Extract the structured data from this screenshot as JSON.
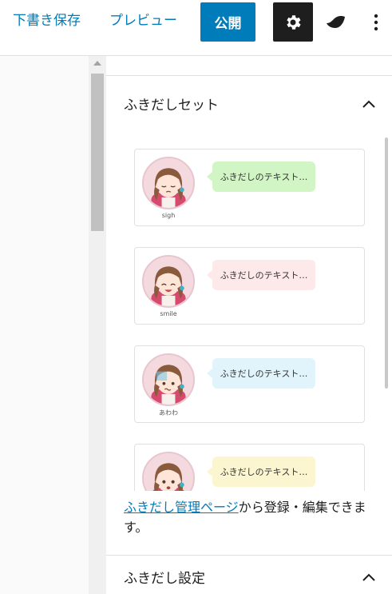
{
  "toolbar": {
    "save_draft": "下書き保存",
    "preview": "プレビュー",
    "publish": "公開",
    "settings_icon": "gear-icon",
    "plugin_icon": "leaf-icon",
    "more_icon": "vertical-ellipsis-icon"
  },
  "colors": {
    "accent": "#007cba",
    "settings_bg": "#1e1e1e"
  },
  "sidebar": {
    "panel_set": {
      "title": "ふきだしセット",
      "expanded": true
    },
    "balloons": [
      {
        "label": "sigh",
        "text": "ふきだしのテキスト…",
        "color": "#d1f5c4",
        "expression": "sigh"
      },
      {
        "label": "smile",
        "text": "ふきだしのテキスト…",
        "color": "#fde8ea",
        "expression": "smile"
      },
      {
        "label": "あわわ",
        "text": "ふきだしのテキスト…",
        "color": "#e1f4fc",
        "expression": "awawa"
      },
      {
        "label": "",
        "text": "ふきだしのテキスト…",
        "color": "#fbf5d0",
        "expression": "surprised"
      }
    ],
    "note": {
      "link_text": "ふきだし管理ページ",
      "rest_text": "から登録・編集できます。"
    },
    "panel_settings": {
      "title": "ふきだし設定",
      "expanded": true
    }
  }
}
